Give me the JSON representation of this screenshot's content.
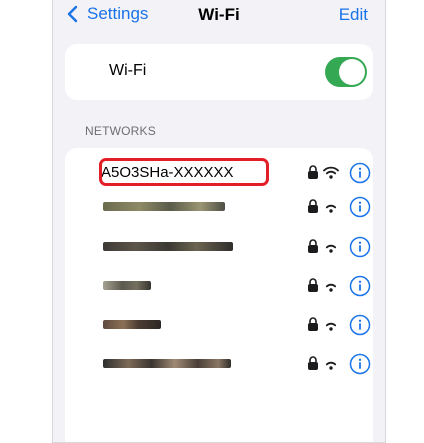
{
  "navbar": {
    "back_label": "Settings",
    "title": "Wi-Fi",
    "edit_label": "Edit"
  },
  "wifi_toggle": {
    "label": "Wi-Fi",
    "state": "on"
  },
  "networks": {
    "header": "NETWORKS",
    "items": [
      {
        "name": "A5O3SHa-XXXXXX",
        "highlighted": true
      },
      {
        "name": "",
        "obscured": true
      },
      {
        "name": "",
        "obscured": true
      },
      {
        "name": "",
        "obscured": true
      },
      {
        "name": "",
        "obscured": true
      },
      {
        "name": "",
        "obscured": true
      }
    ]
  },
  "icons": [
    "chevron-left-icon",
    "lock-icon",
    "wifi-signal-icon",
    "info-icon"
  ],
  "colors": {
    "accent": "#1a73e8",
    "toggle_on": "#34a853",
    "highlight": "#e21f26"
  }
}
